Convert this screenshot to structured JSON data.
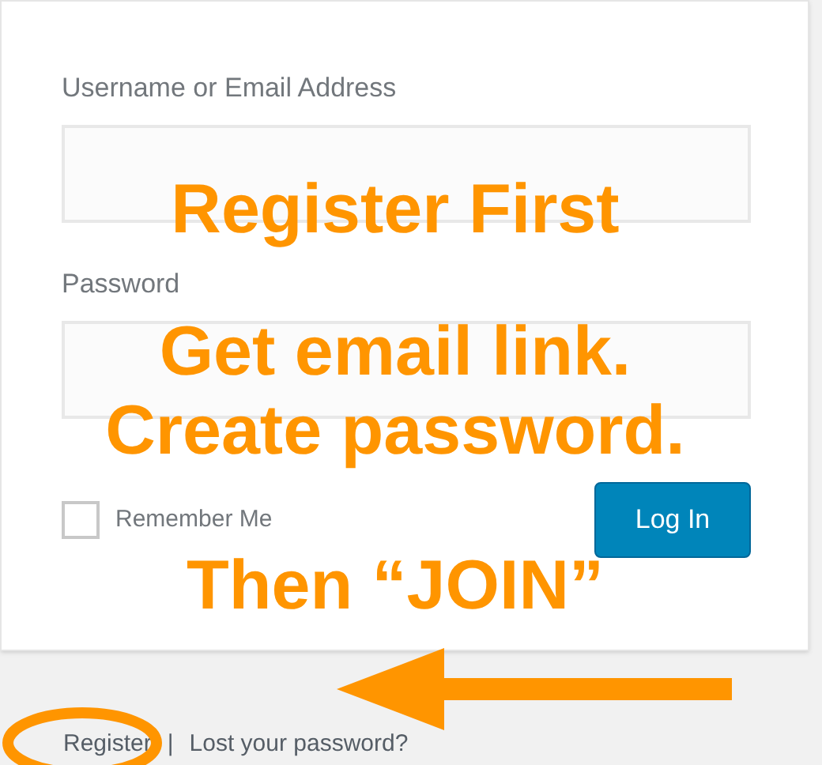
{
  "form": {
    "fields": [
      {
        "label": "Username or Email Address"
      },
      {
        "label": "Password"
      }
    ],
    "remember": {
      "label": "Remember Me",
      "checked": false
    },
    "submit": "Log In"
  },
  "footer": {
    "links": [
      "Register",
      "Lost your password?"
    ],
    "separator": "|"
  },
  "annotation": {
    "lines": [
      "Register First",
      "Get email link.",
      "Create password.",
      "Then “JOIN”"
    ]
  }
}
